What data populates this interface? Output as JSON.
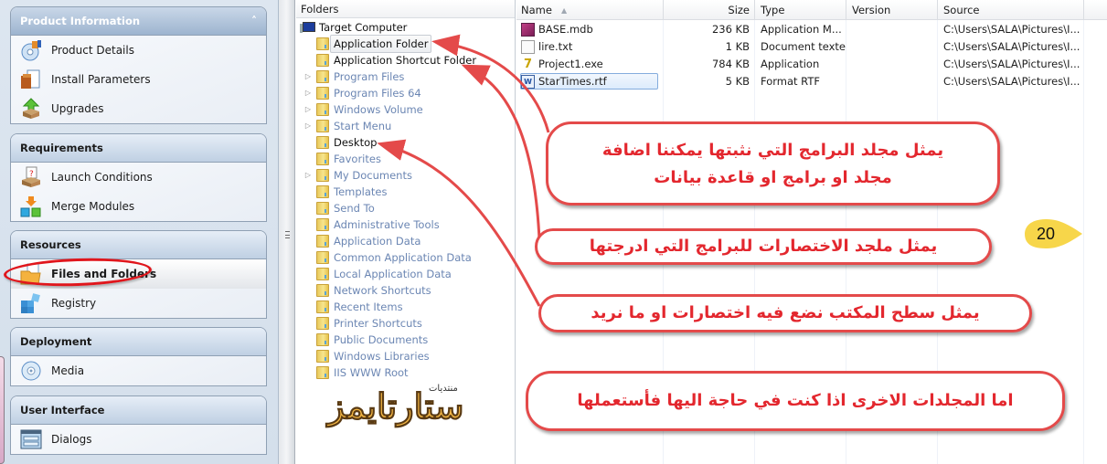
{
  "sidebar": {
    "groups": [
      {
        "title": "Product Information",
        "collapse_icon": "chevron-up-icon",
        "items": [
          {
            "label": "Product Details",
            "icon": "product-details-icon"
          },
          {
            "label": "Install Parameters",
            "icon": "install-parameters-icon"
          },
          {
            "label": "Upgrades",
            "icon": "upgrades-icon"
          }
        ]
      },
      {
        "title": "Requirements",
        "items": [
          {
            "label": "Launch Conditions",
            "icon": "launch-conditions-icon"
          },
          {
            "label": "Merge Modules",
            "icon": "merge-modules-icon"
          }
        ]
      },
      {
        "title": "Resources",
        "items": [
          {
            "label": "Files and Folders",
            "icon": "files-folders-icon",
            "selected": true
          },
          {
            "label": "Registry",
            "icon": "registry-icon"
          }
        ]
      },
      {
        "title": "Deployment",
        "items": [
          {
            "label": "Media",
            "icon": "media-icon"
          }
        ]
      },
      {
        "title": "User Interface",
        "items": [
          {
            "label": "Dialogs",
            "icon": "dialogs-icon"
          }
        ]
      }
    ]
  },
  "folders": {
    "header": "Folders",
    "root": "Target Computer",
    "items": [
      {
        "label": "Application Folder",
        "expandable": false,
        "state": "selected"
      },
      {
        "label": "Application Shortcut Folder",
        "expandable": false,
        "state": "active"
      },
      {
        "label": "Program Files",
        "expandable": true,
        "state": "inactive"
      },
      {
        "label": "Program Files 64",
        "expandable": true,
        "state": "inactive"
      },
      {
        "label": "Windows Volume",
        "expandable": true,
        "state": "inactive"
      },
      {
        "label": "Start Menu",
        "expandable": true,
        "state": "inactive"
      },
      {
        "label": "Desktop",
        "expandable": false,
        "state": "active"
      },
      {
        "label": "Favorites",
        "expandable": false,
        "state": "inactive"
      },
      {
        "label": "My Documents",
        "expandable": true,
        "state": "inactive"
      },
      {
        "label": "Templates",
        "expandable": false,
        "state": "inactive"
      },
      {
        "label": "Send To",
        "expandable": false,
        "state": "inactive"
      },
      {
        "label": "Administrative Tools",
        "expandable": false,
        "state": "inactive"
      },
      {
        "label": "Application Data",
        "expandable": false,
        "state": "inactive"
      },
      {
        "label": "Common Application Data",
        "expandable": false,
        "state": "inactive"
      },
      {
        "label": "Local Application Data",
        "expandable": false,
        "state": "inactive"
      },
      {
        "label": "Network Shortcuts",
        "expandable": false,
        "state": "inactive"
      },
      {
        "label": "Recent Items",
        "expandable": false,
        "state": "inactive"
      },
      {
        "label": "Printer Shortcuts",
        "expandable": false,
        "state": "inactive"
      },
      {
        "label": "Public Documents",
        "expandable": false,
        "state": "inactive"
      },
      {
        "label": "Windows Libraries",
        "expandable": false,
        "state": "inactive"
      },
      {
        "label": "IIS WWW Root",
        "expandable": false,
        "state": "inactive"
      }
    ],
    "watermark_main": "ستارتايمز",
    "watermark_small": "منتديات"
  },
  "files": {
    "columns": [
      "Name",
      "Size",
      "Type",
      "Version",
      "Source"
    ],
    "sort_column": "Name",
    "rows": [
      {
        "name": "BASE.mdb",
        "icon": "access-db-icon",
        "size": "236 KB",
        "type": "Application M...",
        "version": "",
        "source": "C:\\Users\\SALA\\Pictures\\I..."
      },
      {
        "name": "lire.txt",
        "icon": "text-file-icon",
        "size": "1 KB",
        "type": "Document texte",
        "version": "",
        "source": "C:\\Users\\SALA\\Pictures\\I..."
      },
      {
        "name": "Project1.exe",
        "icon": "executable-icon",
        "size": "784 KB",
        "type": "Application",
        "version": "",
        "source": "C:\\Users\\SALA\\Pictures\\I..."
      },
      {
        "name": "StarTimes.rtf",
        "icon": "word-doc-icon",
        "size": "5 KB",
        "type": "Format RTF",
        "version": "",
        "source": "C:\\Users\\SALA\\Pictures\\I...",
        "selected": true
      }
    ]
  },
  "annotations": {
    "application_folder": [
      "يمثل مجلد البرامج التي نثبتها يمكننا اضافة",
      "مجلد او برامج او قاعدة بيانات"
    ],
    "shortcut_folder": "يمثل ملجد الاختصارات للبرامج التي ادرجتها",
    "desktop": "يمثل سطح المكتب نضع فيه اختصارات او ما نريد",
    "other_folders": "اما المجلدات الاخرى اذا كنت في حاجة اليها فأستعملها",
    "page_badge": "20",
    "highlight_color": "#e3272e",
    "badge_color": "#f7d64a"
  }
}
